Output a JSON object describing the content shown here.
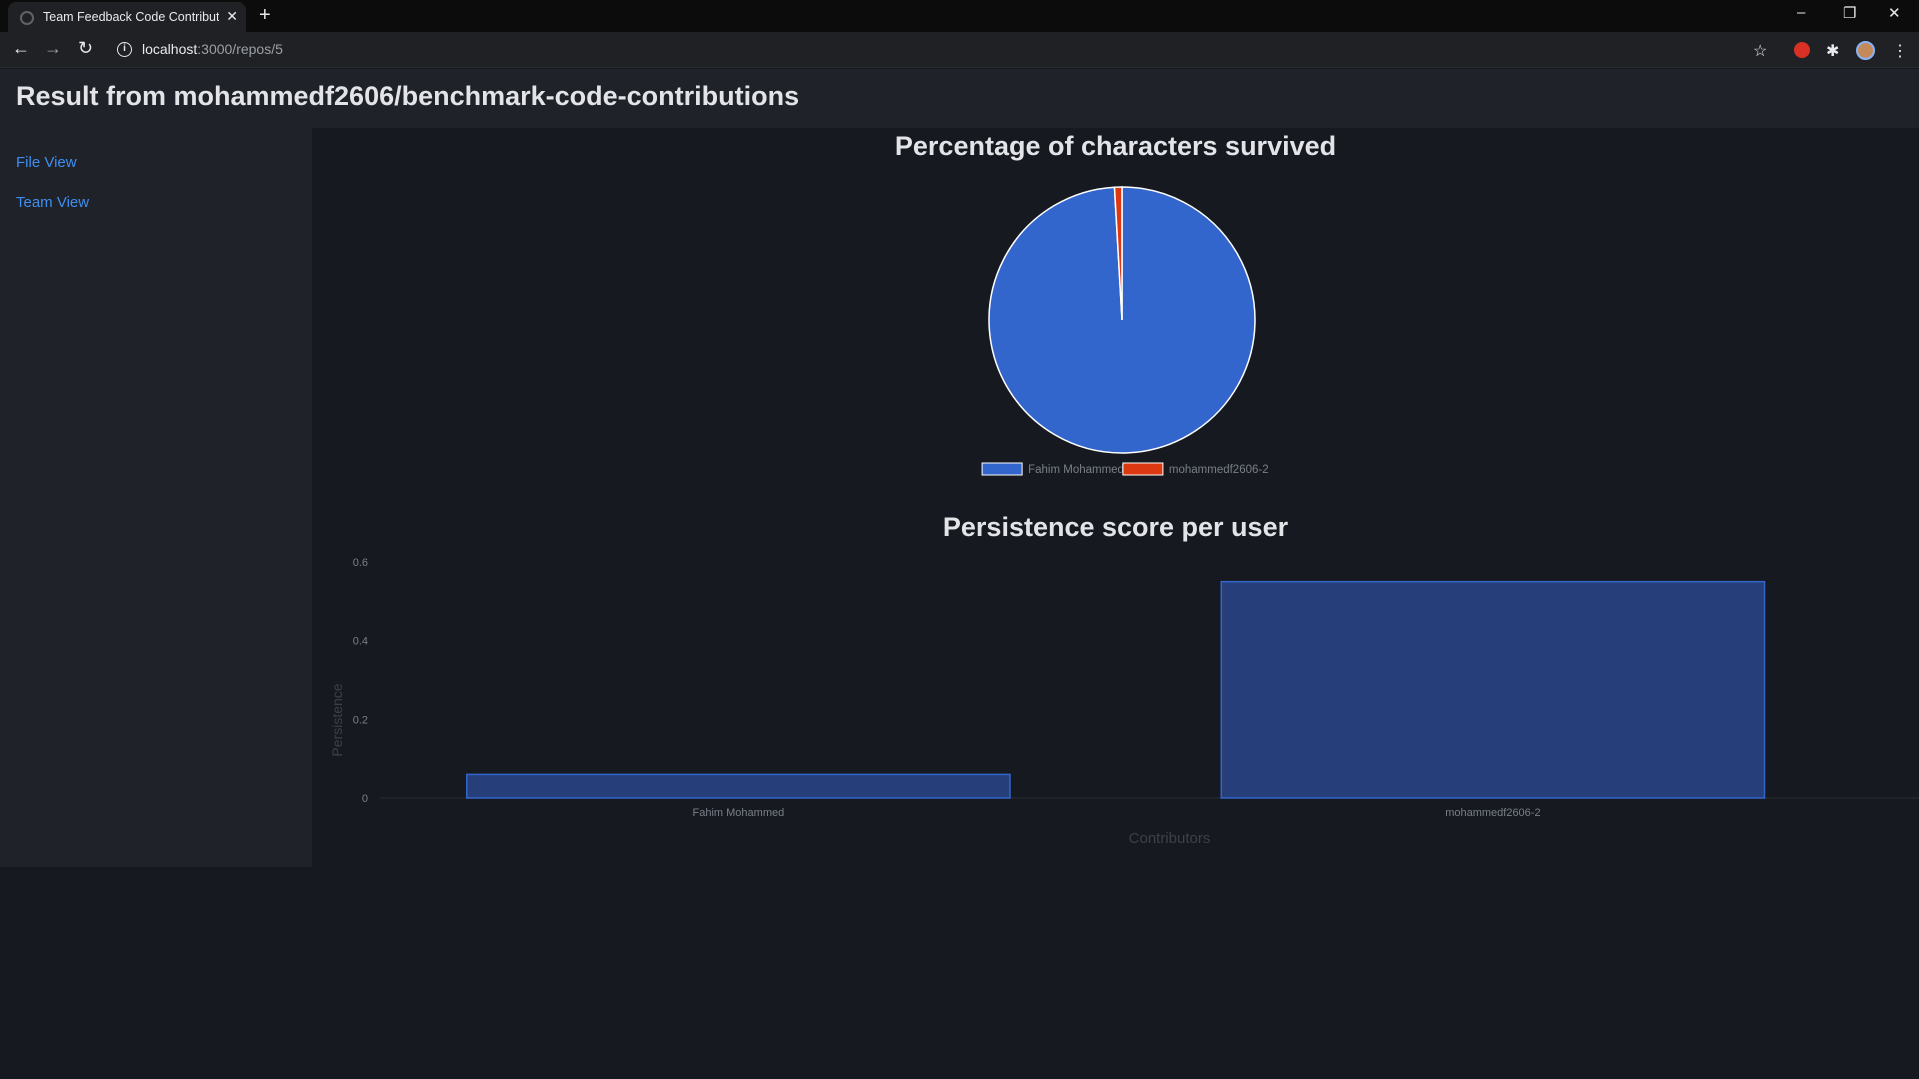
{
  "browser": {
    "tab_title": "Team Feedback Code Contributions",
    "url_host": "localhost",
    "url_path": ":3000/repos/5"
  },
  "header": {
    "title": "Result from mohammedf2606/benchmark-code-contributions"
  },
  "sidebar": {
    "items": [
      {
        "label": "File View"
      },
      {
        "label": "Team View"
      }
    ]
  },
  "colors": {
    "accent": "#3f8ff0",
    "series_a": "#3366cc",
    "series_b": "#dc3912",
    "bar_fill": "#263f7a",
    "bar_stroke": "#3366cc"
  },
  "chart_data": [
    {
      "type": "pie",
      "title": "Percentage of characters survived",
      "categories": [
        "Fahim Mohammed",
        "mohammedf2606-2"
      ],
      "values": [
        99.1,
        0.9
      ],
      "legend": "bottom"
    },
    {
      "type": "bar",
      "title": "Persistence score per user",
      "categories": [
        "Fahim Mohammed",
        "mohammedf2606-2"
      ],
      "values": [
        0.06,
        0.55
      ],
      "xlabel": "Contributors",
      "ylabel": "Persistence",
      "ylim": [
        0,
        0.6
      ],
      "yticks": [
        "0",
        "0.2",
        "0.4",
        "0.6"
      ]
    }
  ]
}
